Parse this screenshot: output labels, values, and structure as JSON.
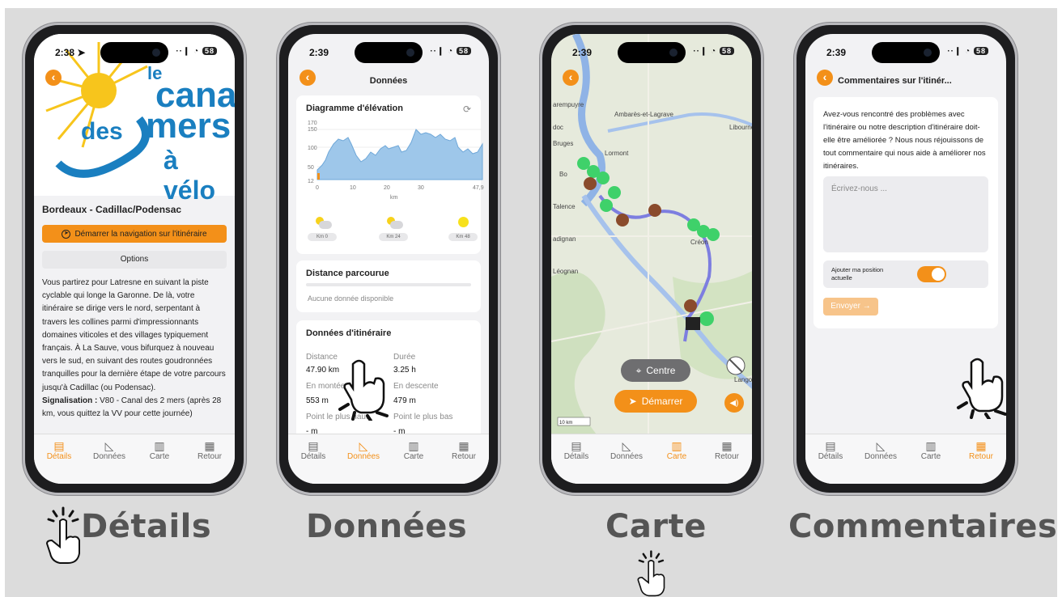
{
  "status": {
    "icons": "··❙ ◔",
    "battery": "58"
  },
  "tabs": [
    "Détails",
    "Données",
    "Carte",
    "Retour"
  ],
  "captions": {
    "details": "Détails",
    "donnees": "Données",
    "carte": "Carte",
    "commentaires": "Commentaires"
  },
  "phone1": {
    "time": "2:38 ➤",
    "logo": {
      "line1": "le",
      "line2": "canal",
      "line3": "des",
      "line3b": "mers",
      "line4": "à vélo"
    },
    "title": "Bordeaux - Cadillac/Podensac",
    "start_button": "Démarrer la navigation sur l'itinéraire",
    "options_button": "Options",
    "description": "Vous partirez pour Latresne en suivant la piste cyclable qui longe la Garonne. De là, votre itinéraire se dirige vers le nord, serpentant à travers les collines parmi d'impressionnants domaines viticoles et des villages typiquement français. À La Sauve, vous bifurquez à nouveau vers le sud, en suivant des routes goudronnées tranquilles pour la dernière étape de votre parcours jusqu'à Cadillac (ou Podensac).",
    "signal_label": "Signalisation :",
    "signal_text": "V80 - Canal des 2 mers (après 28 km, vous quittez la VV pour cette journée)"
  },
  "phone2": {
    "time": "2:39",
    "title": "Données",
    "elevation_title": "Diagramme d'élévation",
    "elevation_y_ticks": [
      "170",
      "150",
      "100",
      "50",
      "12"
    ],
    "elevation_x_ticks": [
      "0",
      "10",
      "20",
      "30",
      "47,9"
    ],
    "elevation_x_unit": "km",
    "weather": [
      {
        "icon": "partly-cloudy-icon",
        "label": "Km 0"
      },
      {
        "icon": "partly-cloudy-icon",
        "label": "Km 24"
      },
      {
        "icon": "sun-icon",
        "label": "Km 48"
      }
    ],
    "distance_title": "Distance parcourue",
    "distance_empty": "Aucune donnée disponible",
    "itinerary_title": "Données d'itinéraire",
    "distance_label": "Distance",
    "distance_value": "47.90 km",
    "duree_label": "Durée",
    "duree_value": "3.25 h",
    "montee_label": "En montée",
    "montee_value": "553 m",
    "descente_label": "En descente",
    "descente_value": "479 m",
    "haut_label": "Point le plus haut",
    "haut_value": "- m",
    "bas_label": "Point le plus bas",
    "bas_value": "- m"
  },
  "phone3": {
    "time": "2:39",
    "places": [
      "arempuyre",
      "Ambarès-et-Lagrave",
      "doc",
      "Bruges",
      "Lormont",
      "Bo",
      "Talence",
      "adignan",
      "Libourne",
      "Léognan",
      "Créon",
      "Langon"
    ],
    "centre_button": "Centre",
    "start_button": "Démarrer",
    "scale": "10 km"
  },
  "phone4": {
    "time": "2:39",
    "title": "Commentaires sur l'itinér...",
    "question": "Avez-vous rencontré des problèmes avec l'itinéraire ou notre description d'itinéraire doit-elle être améliorée ? Nous nous réjouissons de tout commentaire qui nous aide à améliorer nos itinéraires.",
    "placeholder": "Écrivez-nous ...",
    "toggle_label": "Ajouter ma position actuelle",
    "send_button": "Envoyer →"
  },
  "colors": {
    "accent": "#f39019",
    "route": "#7d7ee0",
    "poi_green": "#3fd16a",
    "poi_brown": "#8a4b2c",
    "logo_blue": "#1a7fc0",
    "logo_yellow": "#f7c51c"
  }
}
